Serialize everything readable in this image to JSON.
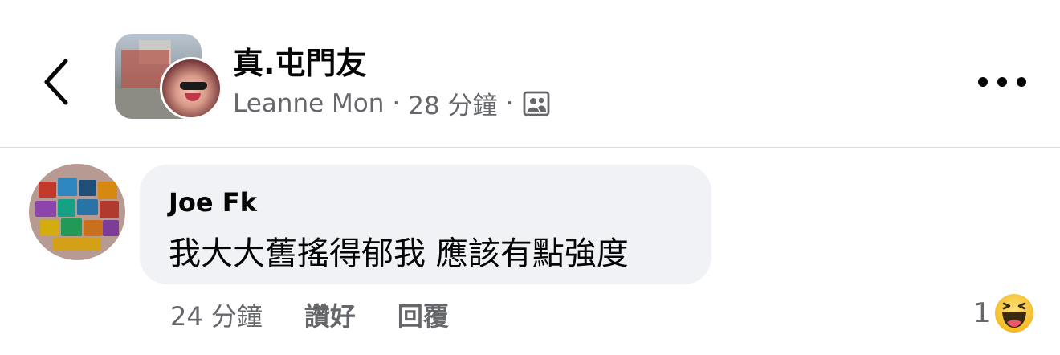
{
  "header": {
    "group_name": "真.屯門友",
    "author_name": "Leanne Mon",
    "separator": "·",
    "time": "28 分鐘",
    "privacy_icon": "group-members-icon",
    "back_icon": "chevron-left-icon",
    "more_icon": "more-horizontal-icon"
  },
  "comment": {
    "author": "Joe Fk",
    "text": "我大大舊搖得郁我 應該有點強度",
    "time": "24 分鐘",
    "like_label": "讚好",
    "reply_label": "回覆",
    "reaction_count": "1",
    "reaction_icon": "haha-reaction-icon"
  },
  "colors": {
    "text_primary": "#050505",
    "text_secondary": "#65676b",
    "bubble_bg": "#f0f2f5",
    "divider": "#dcdde0",
    "reaction_yellow": "#f7b125"
  }
}
